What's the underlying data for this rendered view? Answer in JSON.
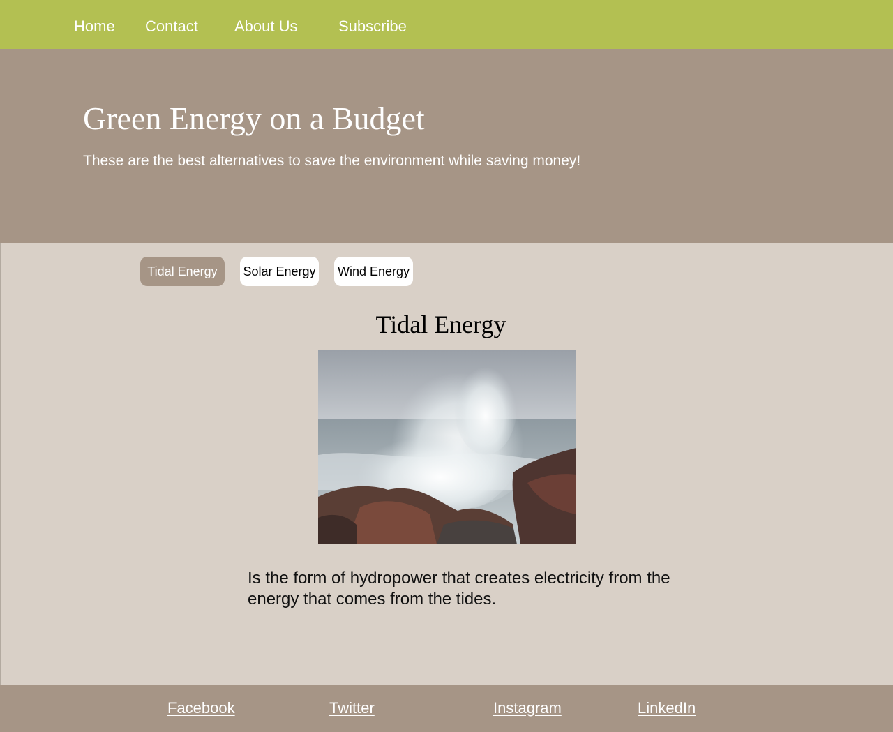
{
  "nav": {
    "home": "Home",
    "contact": "Contact",
    "about": "About Us",
    "subscribe": "Subscribe"
  },
  "hero": {
    "title": "Green Energy on a Budget",
    "subtitle": "These are the best alternatives to save the environment while saving money!"
  },
  "tabs": [
    {
      "label": "Tidal Energy",
      "active": true
    },
    {
      "label": "Solar Energy",
      "active": false
    },
    {
      "label": "Wind Energy",
      "active": false
    }
  ],
  "content": {
    "title": "Tidal Energy",
    "image_subject": "waves-crashing-on-rocks",
    "description": "Is the form of hydropower that creates electricity from the energy that comes from the tides."
  },
  "footer": {
    "facebook": "Facebook",
    "twitter": "Twitter",
    "instagram": "Instagram",
    "linkedin": "LinkedIn"
  },
  "colors": {
    "nav_bg": "#b3c052",
    "hero_bg": "#a69586",
    "main_bg": "#d9d0c7",
    "active_tab": "#a69586",
    "inactive_tab": "#ffffff",
    "footer_bg": "#a69586"
  }
}
